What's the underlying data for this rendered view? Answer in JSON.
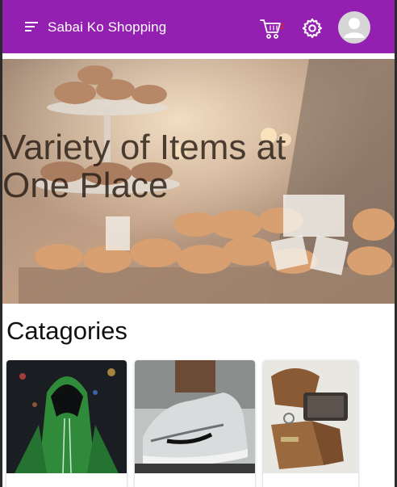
{
  "appbar": {
    "title": "Sabai Ko Shopping",
    "background": "#9320b1",
    "menu_icon": "sort-menu-icon",
    "cart_icon": "cart-icon",
    "cart_count": "1",
    "settings_icon": "gear-icon",
    "avatar_icon": "person-icon"
  },
  "hero": {
    "title": "Variety of Items at One Place"
  },
  "categories": {
    "heading": "Catagories",
    "items": [
      {
        "image": "green-hoodie-photo",
        "label": ""
      },
      {
        "image": "sneaker-photo",
        "label": ""
      },
      {
        "image": "leather-bag-photo",
        "label": ""
      }
    ]
  }
}
